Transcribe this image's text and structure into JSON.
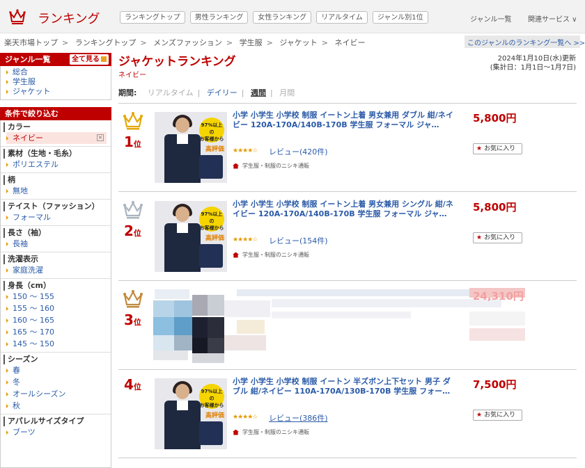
{
  "header": {
    "brand": "ランキング",
    "tabs": [
      "ランキングトップ",
      "男性ランキング",
      "女性ランキング",
      "リアルタイム",
      "ジャンル別1位"
    ],
    "genre_list": "ジャンル一覧",
    "related": "関連サービス ∨"
  },
  "breadcrumb": [
    "楽天市場トップ",
    "ランキングトップ",
    "メンズファッション",
    "学生服",
    "ジャケット",
    "ネイビー"
  ],
  "breadcrumb_sep": ">",
  "genre_ranking_link": "このジャンルのランキング一覧へ >>",
  "sidebar": {
    "genre_title": "ジャンル一覧",
    "see_all": "全て見る",
    "genres": [
      "総合",
      "学生服",
      "ジャケット"
    ],
    "filter_title": "条件で絞り込む",
    "filters": [
      {
        "title": "カラー",
        "items": [
          "ネイビー"
        ],
        "active": 0
      },
      {
        "title": "素材（生地・毛糸）",
        "items": [
          "ポリエステル"
        ]
      },
      {
        "title": "柄",
        "items": [
          "無地"
        ]
      },
      {
        "title": "テイスト（ファッション）",
        "items": [
          "フォーマル"
        ]
      },
      {
        "title": "長さ（袖）",
        "items": [
          "長袖"
        ]
      },
      {
        "title": "洗濯表示",
        "items": [
          "家庭洗濯"
        ]
      },
      {
        "title": "身長（cm）",
        "items": [
          "150 ～ 155",
          "155 ～ 160",
          "160 ～ 165",
          "165 ～ 170",
          "145 ～ 150"
        ]
      },
      {
        "title": "シーズン",
        "items": [
          "春",
          "冬",
          "オールシーズン",
          "秋"
        ]
      },
      {
        "title": "アパレルサイズタイプ",
        "items": [
          "ブーツ"
        ]
      }
    ],
    "remove_icon": "×"
  },
  "main": {
    "title": "ジャケットランキング",
    "subtitle": "ネイビー",
    "updated": "2024年1月10日(水)更新",
    "period_range": "(集計日：1月1日～1月7日)",
    "period_label": "期間:",
    "periods": [
      "リアルタイム",
      "デイリー",
      "週間",
      "月間"
    ],
    "period_current": 2
  },
  "fav_label": "お気に入り",
  "badge_text": [
    "97%以上の",
    "お客様から",
    "高評価"
  ],
  "items": [
    {
      "rank": "1",
      "rank_suffix": "位",
      "title": "小学 小学生 小学校 制服 イートン上着 男女兼用 ダブル 紺/ネイビー 120A-170A/140B-170B 学生服 フォーマル ジャ…",
      "price": "5,800円",
      "stars": "★★★★☆",
      "review": "レビュー(420件)",
      "shop": "学生服・制服のニシキ通販",
      "crown": "gold"
    },
    {
      "rank": "2",
      "rank_suffix": "位",
      "title": "小学 小学生 小学校 制服 イートン上着 男女兼用 シングル 紺/ネイビー 120A-170A/140B-170B 学生服 フォーマル ジャ…",
      "price": "5,800円",
      "stars": "★★★★☆",
      "review": "レビュー(154件)",
      "shop": "学生服・制服のニシキ通販",
      "crown": "silver"
    },
    {
      "rank": "3",
      "rank_suffix": "位",
      "title": "",
      "price": "24,310円",
      "stars": "",
      "review": "",
      "shop": "",
      "crown": "bronze"
    },
    {
      "rank": "4",
      "rank_suffix": "位",
      "title": "小学 小学生 小学校 制服 イートン 半ズボン上下セット 男子 ダブル 紺/ネイビー 110A-170A/130B-170B 学生服 フォー…",
      "price": "7,500円",
      "stars": "★★★★☆",
      "review": "レビュー(386件)",
      "shop": "学生服・制服のニシキ通販",
      "crown": "none"
    }
  ]
}
